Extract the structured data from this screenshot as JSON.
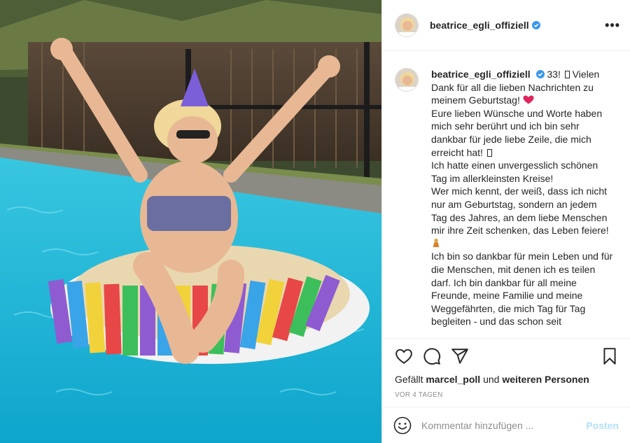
{
  "post": {
    "username": "beatrice_egli_offiziell",
    "verified": true,
    "more_icon": "more-options-icon",
    "caption": {
      "username": "beatrice_egli_offiziell",
      "line1": " 33! ",
      "line2": " Vielen Dank für all die lieben Nachrichten zu meinem Geburtstag! ",
      "line3": "Eure lieben Wünsche und Worte haben mich sehr berührt und ich bin sehr dankbar für jede liebe Zeile, die mich erreicht hat! ",
      "line4": "Ich hatte einen unvergesslich schönen Tag im allerkleinsten Kreise!",
      "line5": "Wer mich kennt, der weiß, dass ich nicht nur am Geburtstag, sondern an jedem Tag des Jahres, an dem liebe Menschen mir ihre Zeit schenken, das Leben feiere! ",
      "line6": "Ich bin so dankbar für mein Leben und für die Menschen, mit denen ich es teilen darf. Ich bin dankbar für all meine Freunde, meine Familie und meine Weggefährten, die mich Tag für Tag begleiten - und das schon seit"
    },
    "likes": {
      "prefix": "Gefällt ",
      "user": "marcel_poll",
      "middle": " und ",
      "rest": "weiteren Personen"
    },
    "timestamp": "VOR 4 TAGEN",
    "comment": {
      "placeholder": "Kommentar hinzufügen ...",
      "post_label": "Posten"
    }
  },
  "colors": {
    "verified_blue": "#3897f0",
    "post_button": "#b2dffc",
    "heart_red": "#e0245e",
    "pool": "#1fb3d4"
  }
}
